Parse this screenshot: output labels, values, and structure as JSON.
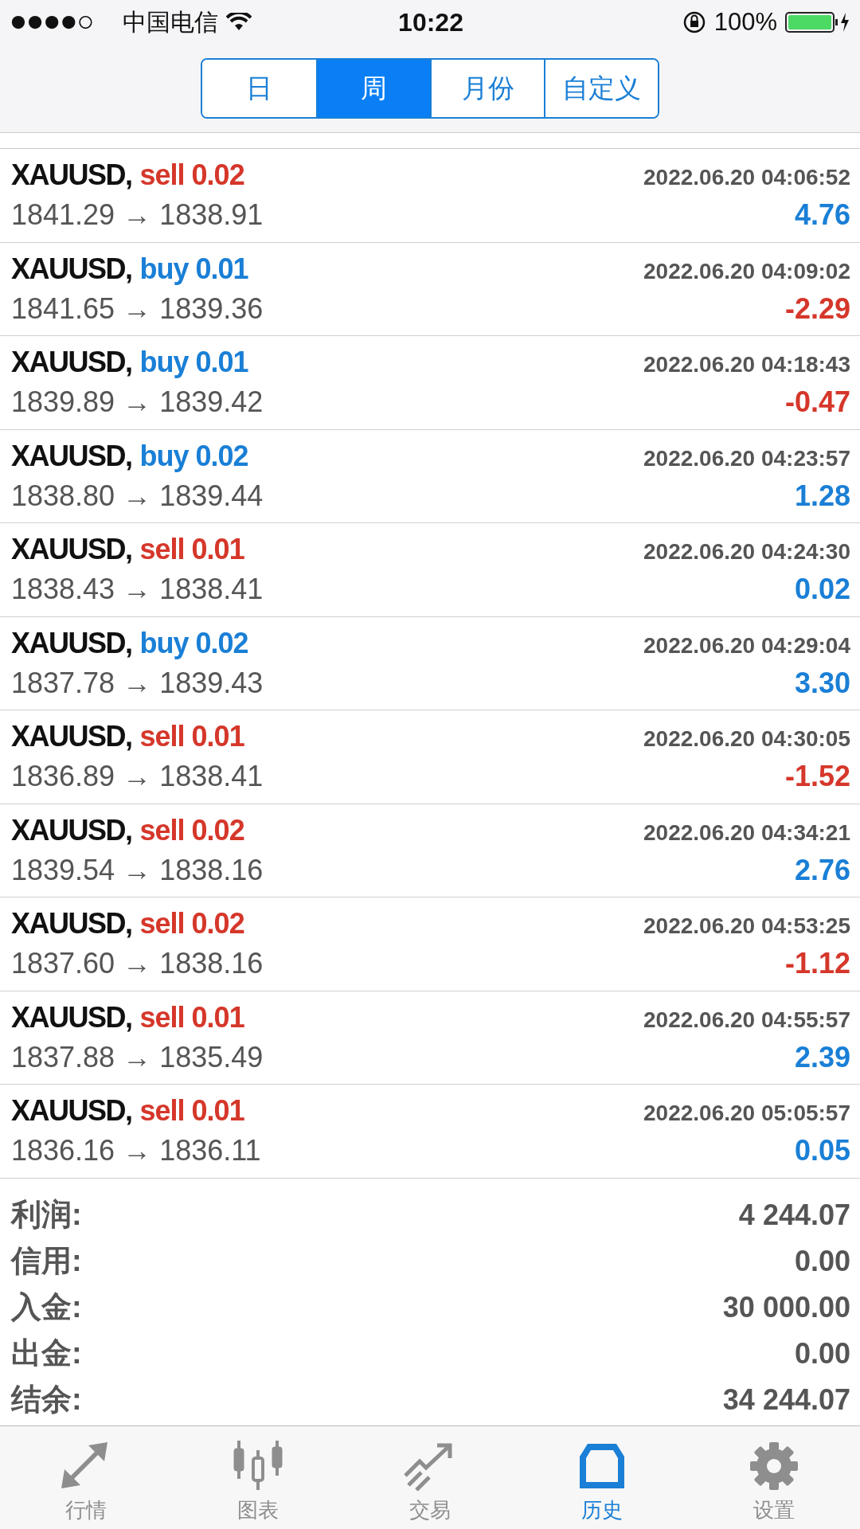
{
  "status_bar": {
    "carrier": "中国电信",
    "time": "10:22",
    "battery": "100%"
  },
  "tabs": [
    {
      "label": "日",
      "selected": false
    },
    {
      "label": "周",
      "selected": true
    },
    {
      "label": "月份",
      "selected": false
    },
    {
      "label": "自定义",
      "selected": false
    }
  ],
  "deals": [
    {
      "symbol": "XAUUSD,",
      "order": "sell 0.02",
      "kind": "sell",
      "time": "2022.06.20 04:06:52",
      "prices": "1841.29 → 1838.91",
      "profit": "4.76",
      "loss": false
    },
    {
      "symbol": "XAUUSD,",
      "order": "buy 0.01",
      "kind": "buy",
      "time": "2022.06.20 04:09:02",
      "prices": "1841.65 → 1839.36",
      "profit": "-2.29",
      "loss": true
    },
    {
      "symbol": "XAUUSD,",
      "order": "buy 0.01",
      "kind": "buy",
      "time": "2022.06.20 04:18:43",
      "prices": "1839.89 → 1839.42",
      "profit": "-0.47",
      "loss": true
    },
    {
      "symbol": "XAUUSD,",
      "order": "buy 0.02",
      "kind": "buy",
      "time": "2022.06.20 04:23:57",
      "prices": "1838.80 → 1839.44",
      "profit": "1.28",
      "loss": false
    },
    {
      "symbol": "XAUUSD,",
      "order": "sell 0.01",
      "kind": "sell",
      "time": "2022.06.20 04:24:30",
      "prices": "1838.43 → 1838.41",
      "profit": "0.02",
      "loss": false
    },
    {
      "symbol": "XAUUSD,",
      "order": "buy 0.02",
      "kind": "buy",
      "time": "2022.06.20 04:29:04",
      "prices": "1837.78 → 1839.43",
      "profit": "3.30",
      "loss": false
    },
    {
      "symbol": "XAUUSD,",
      "order": "sell 0.01",
      "kind": "sell",
      "time": "2022.06.20 04:30:05",
      "prices": "1836.89 → 1838.41",
      "profit": "-1.52",
      "loss": true
    },
    {
      "symbol": "XAUUSD,",
      "order": "sell 0.02",
      "kind": "sell",
      "time": "2022.06.20 04:34:21",
      "prices": "1839.54 → 1838.16",
      "profit": "2.76",
      "loss": false
    },
    {
      "symbol": "XAUUSD,",
      "order": "sell 0.02",
      "kind": "sell",
      "time": "2022.06.20 04:53:25",
      "prices": "1837.60 → 1838.16",
      "profit": "-1.12",
      "loss": true
    },
    {
      "symbol": "XAUUSD,",
      "order": "sell 0.01",
      "kind": "sell",
      "time": "2022.06.20 04:55:57",
      "prices": "1837.88 → 1835.49",
      "profit": "2.39",
      "loss": false
    },
    {
      "symbol": "XAUUSD,",
      "order": "sell 0.01",
      "kind": "sell",
      "time": "2022.06.20 05:05:57",
      "prices": "1836.16 → 1836.11",
      "profit": "0.05",
      "loss": false
    }
  ],
  "summary": [
    {
      "label": "利润:",
      "value": "4 244.07"
    },
    {
      "label": "信用:",
      "value": "0.00"
    },
    {
      "label": "入金:",
      "value": "30 000.00"
    },
    {
      "label": "出金:",
      "value": "0.00"
    },
    {
      "label": "结余:",
      "value": "34 244.07"
    }
  ],
  "tab_bar": [
    {
      "label": "行情",
      "kind": "quotes",
      "selected": false
    },
    {
      "label": "图表",
      "kind": "chart",
      "selected": false
    },
    {
      "label": "交易",
      "kind": "trade",
      "selected": false
    },
    {
      "label": "历史",
      "kind": "history",
      "selected": true
    },
    {
      "label": "设置",
      "kind": "settings",
      "selected": false
    }
  ]
}
